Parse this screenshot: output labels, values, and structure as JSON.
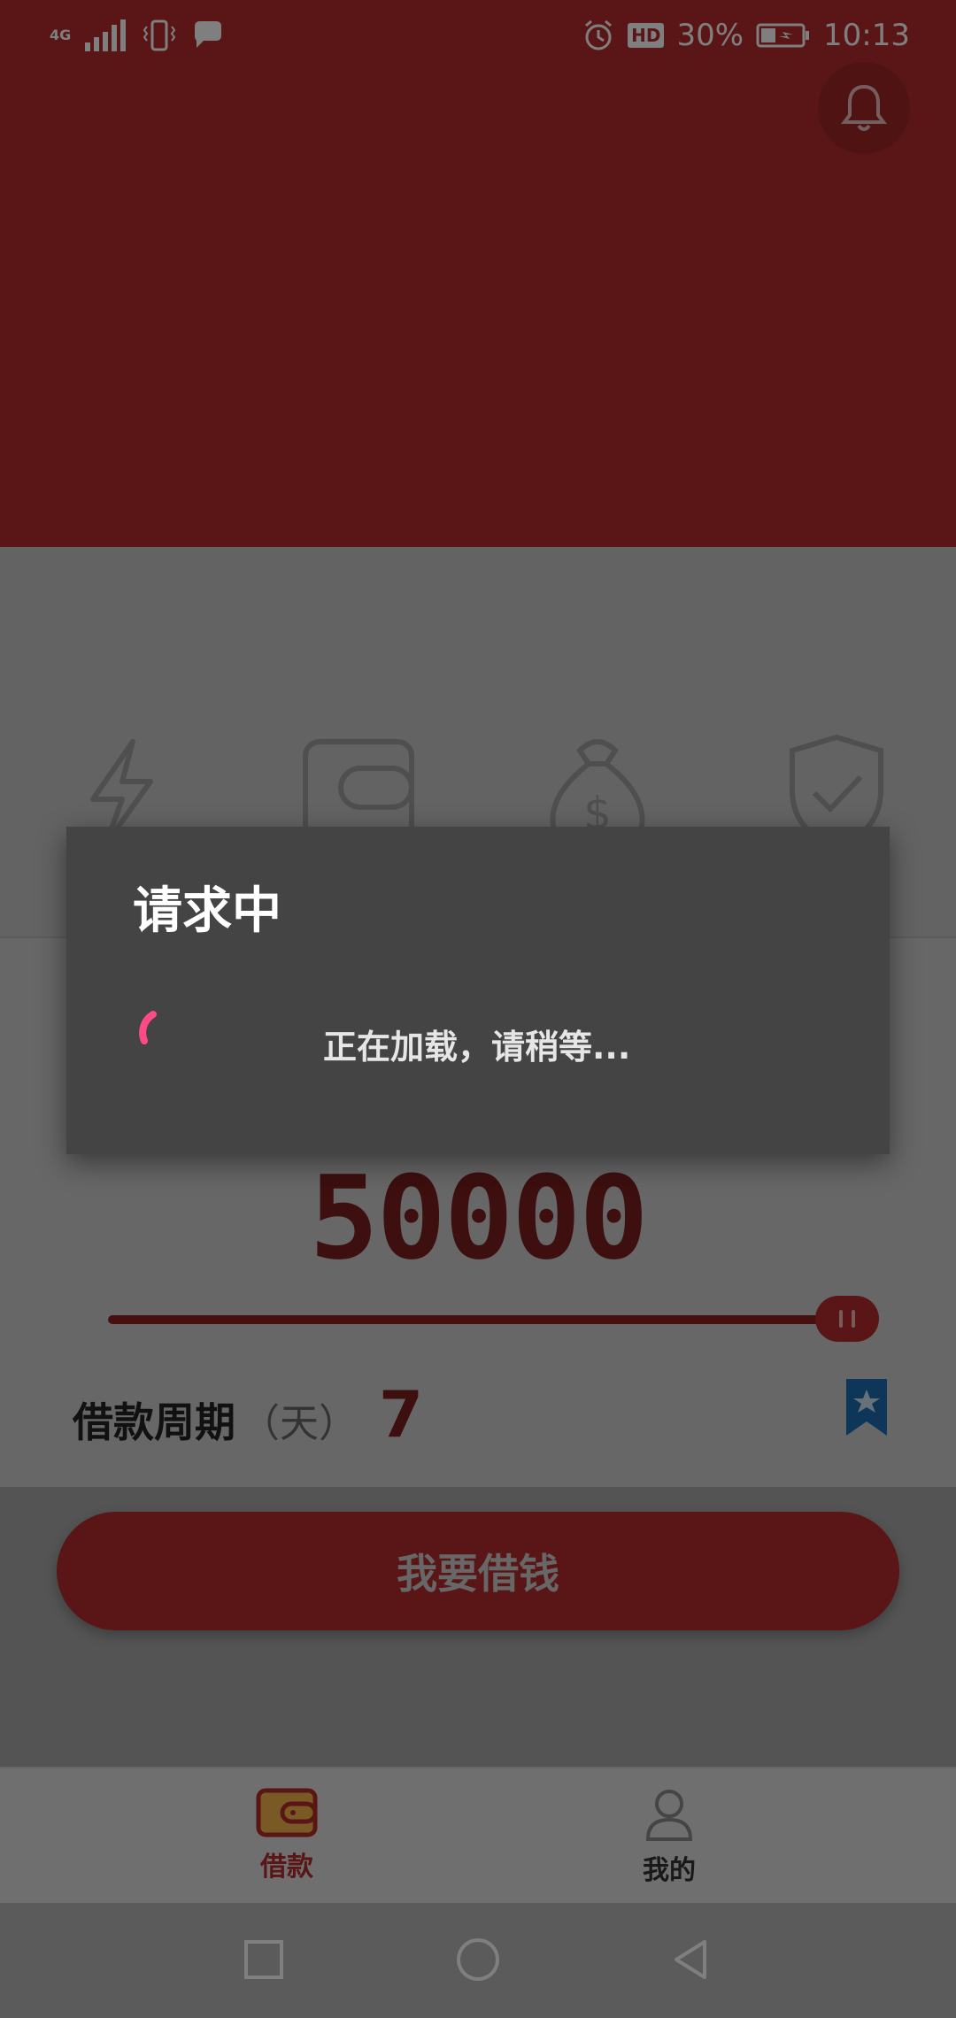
{
  "status_bar": {
    "network": "4G",
    "battery_percent": "30%",
    "time": "10:13",
    "hd_badge": "HD"
  },
  "loan": {
    "amount": "50000",
    "slider_fraction": 1.0,
    "period_label": "借款周期",
    "period_unit": "（天）",
    "period_value": "7",
    "borrow_button": "我要借钱"
  },
  "tabs": [
    {
      "label": "借款",
      "active": true
    },
    {
      "label": "我的",
      "active": false
    }
  ],
  "dialog": {
    "title": "请求中",
    "message": "正在加载，请稍等..."
  },
  "colors": {
    "brand_red": "#b52c2c",
    "spinner_pink": "#ff4a8a",
    "bookmark_blue": "#1a6cb3",
    "wallet_yellow": "#f3b54a"
  }
}
